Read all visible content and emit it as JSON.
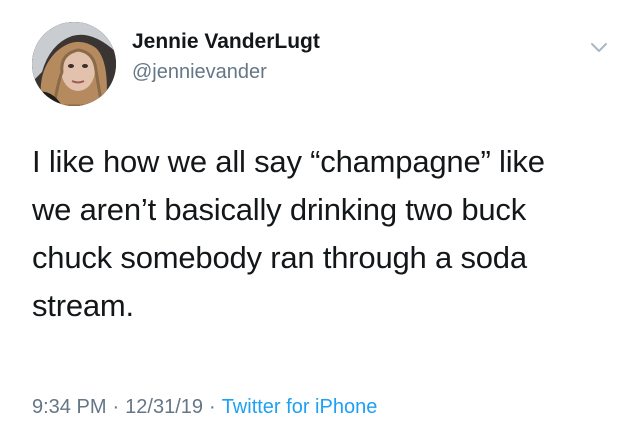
{
  "tweet": {
    "author": {
      "display_name": "Jennie VanderLugt",
      "handle": "@jennievander"
    },
    "text_lines": [
      "I like how we all say “champagne” like",
      "we aren’t basically drinking two buck",
      "chuck somebody ran through a soda",
      "stream."
    ],
    "meta": {
      "time": "9:34 PM",
      "separator": "·",
      "date": "12/31/19",
      "source": "Twitter for iPhone"
    }
  },
  "icons": {
    "caret": "chevron-down-icon",
    "avatar": "profile-photo"
  },
  "colors": {
    "text": "#14171a",
    "secondary": "#657786",
    "link": "#1da1f2",
    "background": "#ffffff"
  }
}
